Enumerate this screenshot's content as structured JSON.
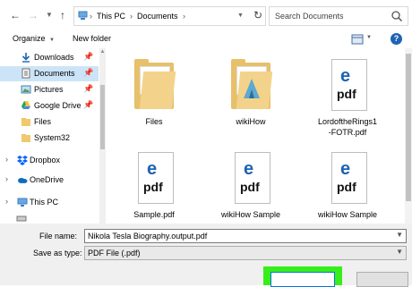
{
  "address_bar": {
    "back_icon": "arrow-left",
    "forward_icon": "arrow-right",
    "dropdown_icon": "chevron-down",
    "up_icon": "arrow-up",
    "breadcrumbs": [
      "This PC",
      "Documents"
    ],
    "search_placeholder": "Search Documents"
  },
  "toolbar": {
    "organize_label": "Organize",
    "new_folder_label": "New folder",
    "help_label": "?"
  },
  "nav_pane": {
    "items": [
      {
        "label": "Downloads",
        "icon": "download-icon",
        "pinned": true
      },
      {
        "label": "Documents",
        "icon": "documents-icon",
        "pinned": true,
        "selected": true
      },
      {
        "label": "Pictures",
        "icon": "pictures-icon",
        "pinned": true
      },
      {
        "label": "Google Drive",
        "icon": "google-drive-icon",
        "pinned": true
      },
      {
        "label": "Files",
        "icon": "folder-icon"
      },
      {
        "label": "System32",
        "icon": "folder-icon"
      },
      {
        "label": "Dropbox",
        "icon": "dropbox-icon"
      },
      {
        "label": "OneDrive",
        "icon": "onedrive-icon"
      },
      {
        "label": "This PC",
        "icon": "pc-icon"
      }
    ]
  },
  "files": [
    {
      "name": "Files",
      "type": "folder"
    },
    {
      "name": "wikiHow",
      "type": "folder"
    },
    {
      "name": "LordoftheRings1\n-FOTR.pdf",
      "type": "pdf"
    },
    {
      "name": "Sample.pdf",
      "type": "pdf"
    },
    {
      "name": "wikiHow Sample",
      "type": "pdf"
    },
    {
      "name": "wikiHow Sample",
      "type": "pdf"
    }
  ],
  "save_panel": {
    "file_name_label": "File name:",
    "file_name_value": "Nikola Tesla Biography.output.pdf",
    "save_as_type_label": "Save as type:",
    "save_as_type_value": "PDF File (.pdf)"
  },
  "colors": {
    "accent": "#1e63b3",
    "selection": "#cce4f7",
    "highlight": "#37ee1a",
    "folder": "#e8c06a"
  }
}
